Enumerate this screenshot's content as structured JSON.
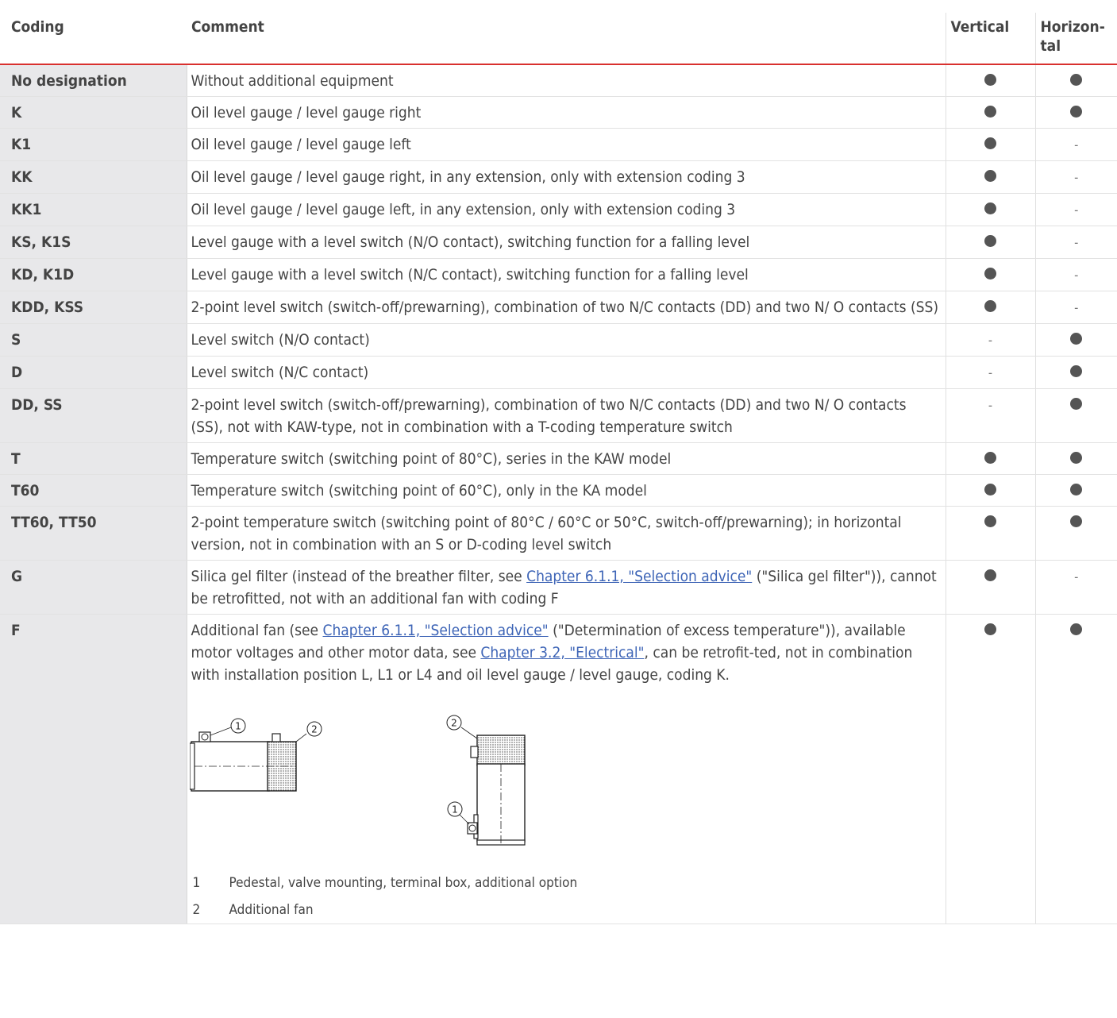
{
  "headers": [
    "Coding",
    "Comment",
    "Vertical",
    "Horizon-\ntal"
  ],
  "rows": [
    {
      "code": "No designation",
      "comment": "Without additional equipment",
      "vertical": "dot",
      "horizontal": "dot"
    },
    {
      "code": "K",
      "comment": "Oil level gauge / level gauge right",
      "vertical": "dot",
      "horizontal": "dot"
    },
    {
      "code": "K1",
      "comment": "Oil level gauge / level gauge left",
      "vertical": "dot",
      "horizontal": "-"
    },
    {
      "code": "KK",
      "comment": "Oil level gauge / level gauge right, in any extension, only with extension coding 3",
      "vertical": "dot",
      "horizontal": "-"
    },
    {
      "code": "KK1",
      "comment": "Oil level gauge / level gauge left, in any extension, only with extension coding 3",
      "vertical": "dot",
      "horizontal": "-"
    },
    {
      "code": "KS, K1S",
      "comment": "Level gauge with a level switch (N/O contact), switching function for a falling level",
      "vertical": "dot",
      "horizontal": "-"
    },
    {
      "code": "KD, K1D",
      "comment": "Level gauge with a level switch (N/C contact), switching function for a falling level",
      "vertical": "dot",
      "horizontal": "-"
    },
    {
      "code": "KDD, KSS",
      "comment": "2-point level switch (switch-off/prewarning), combination of two N/C contacts (DD) and two N/ O contacts (SS)",
      "vertical": "dot",
      "horizontal": "-"
    },
    {
      "code": "S",
      "comment": "Level switch (N/O contact)",
      "vertical": "-",
      "horizontal": "dot"
    },
    {
      "code": "D",
      "comment": "Level switch (N/C contact)",
      "vertical": "-",
      "horizontal": "dot"
    },
    {
      "code": "DD, SS",
      "comment": "2-point level switch (switch-off/prewarning), combination of two N/C contacts (DD) and two N/ O contacts (SS), not with KAW-type, not in combination with a T-coding temperature switch",
      "vertical": "-",
      "horizontal": "dot"
    },
    {
      "code": "T",
      "comment": "Temperature switch (switching point of 80°C), series in the KAW model",
      "vertical": "dot",
      "horizontal": "dot"
    },
    {
      "code": "T60",
      "comment": "Temperature switch (switching point of 60°C), only in the KA model",
      "vertical": "dot",
      "horizontal": "dot"
    },
    {
      "code": "TT60, TT50",
      "comment": "2-point temperature switch (switching point of 80°C / 60°C or 50°C, switch-off/prewarning); in horizontal version, not in combination with an S or D-coding level switch",
      "vertical": "dot",
      "horizontal": "dot"
    }
  ],
  "row_g": {
    "code": "G",
    "pre": "Silica gel filter (instead of the breather filter, see ",
    "link": "Chapter 6.1.1, \"Selection advice\"",
    "post": " (\"Silica gel filter\")), cannot be retrofitted, not with an additional fan with coding F",
    "vertical": "dot",
    "horizontal": "-"
  },
  "row_f": {
    "code": "F",
    "pre": "Additional fan (see ",
    "link1": "Chapter 6.1.1, \"Selection advice\"",
    "mid": " (\"Determination of excess temperature\")), available motor voltages and other motor data, see ",
    "link2": "Chapter 3.2, \"Electrical\"",
    "post": ", can be retrofit-ted, not in combination with installation position L, L1 or L4 and oil level gauge / level gauge, coding K.",
    "vertical": "dot",
    "horizontal": "dot",
    "callout_1": "1",
    "callout_2": "2",
    "legend": [
      {
        "num": "1",
        "text": "Pedestal, valve mounting, terminal box, additional option"
      },
      {
        "num": "2",
        "text": "Additional fan"
      }
    ]
  }
}
